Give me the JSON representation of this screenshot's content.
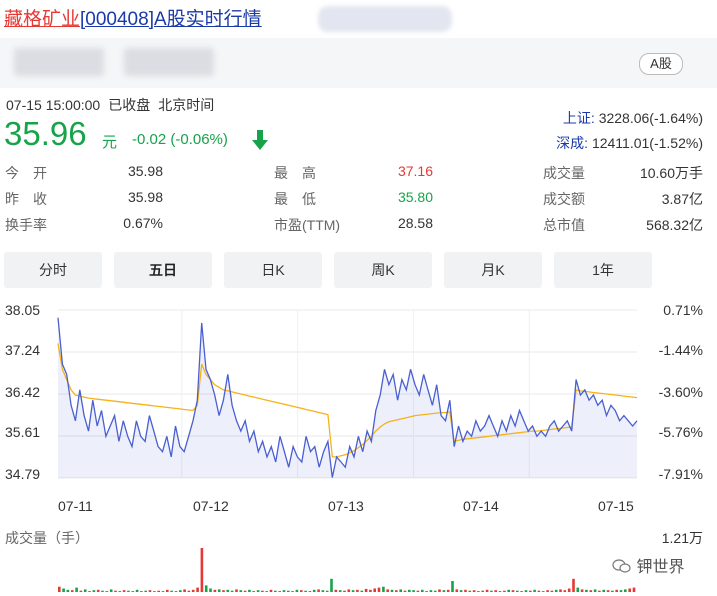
{
  "header": {
    "name_link": "藏格矿业",
    "code_link": "[000408]",
    "title_rest": "A股实时行情",
    "badge": "A股"
  },
  "status": {
    "datetime": "07-15 15:00:00",
    "state": "已收盘",
    "timezone": "北京时间"
  },
  "quote": {
    "price": "35.96",
    "unit": "元",
    "change": "-0.02 (-0.06%)"
  },
  "indices": [
    {
      "label": "上证:",
      "value": "3228.06(-1.64%)"
    },
    {
      "label": "深成:",
      "value": "12411.01(-1.52%)"
    }
  ],
  "stats": [
    {
      "label": "今　开",
      "value": "35.98",
      "color": "#333333"
    },
    {
      "label": "最　高",
      "value": "37.16",
      "color": "#e53935"
    },
    {
      "label": "成交量",
      "value": "10.60万手",
      "color": "#333333"
    },
    {
      "label": "昨　收",
      "value": "35.98",
      "color": "#333333"
    },
    {
      "label": "最　低",
      "value": "35.80",
      "color": "#16a34a"
    },
    {
      "label": "成交额",
      "value": "3.87亿",
      "color": "#333333"
    },
    {
      "label": "换手率",
      "value": "0.67%",
      "color": "#333333"
    },
    {
      "label": "市盈(TTM)",
      "value": "28.58",
      "color": "#333333"
    },
    {
      "label": "总市值",
      "value": "568.32亿",
      "color": "#333333"
    }
  ],
  "tabs": [
    "分时",
    "五日",
    "日K",
    "周K",
    "月K",
    "1年"
  ],
  "active_tab": "五日",
  "colors": {
    "up": "#e53935",
    "down": "#16a34a",
    "price_line": "#4a5fd0",
    "avg_line": "#f5b21a",
    "link": "#1a3aa8"
  },
  "chart_data": {
    "type": "line",
    "y_labels_left": [
      "38.05",
      "37.24",
      "36.42",
      "35.61",
      "34.79"
    ],
    "y_labels_right": [
      "0.71%",
      "-1.44%",
      "-3.60%",
      "-5.76%",
      "-7.91%"
    ],
    "ylim": [
      34.79,
      38.05
    ],
    "x_labels": [
      "07-11",
      "07-12",
      "07-13",
      "07-14",
      "07-15"
    ],
    "grid": true,
    "series": [
      {
        "values": [
          37.9,
          37.0,
          36.8,
          36.2,
          35.9,
          36.5,
          36.0,
          35.7,
          36.3,
          35.8,
          36.1,
          35.6,
          35.8,
          36.0,
          35.5,
          35.9,
          35.6,
          35.4,
          35.9,
          35.6,
          35.5,
          36.0,
          35.7,
          35.4,
          35.3,
          35.6,
          35.2,
          35.8,
          35.4,
          35.3,
          35.6,
          35.9,
          36.3,
          37.8,
          36.9,
          36.7,
          36.4,
          36.0,
          36.3,
          36.8,
          36.2,
          35.9,
          35.7,
          35.9,
          35.5,
          35.7,
          35.3,
          35.5,
          35.2,
          35.4,
          35.1,
          35.6,
          35.3,
          35.0,
          35.4,
          35.2,
          35.1,
          35.6,
          35.3,
          35.4,
          35.0,
          35.3,
          35.5,
          34.8,
          35.2,
          35.1,
          35.0,
          35.4,
          35.2,
          35.6,
          35.3,
          35.7,
          35.5,
          36.1,
          36.4,
          36.9,
          36.6,
          36.8,
          36.3,
          36.7,
          36.5,
          36.9,
          36.6,
          36.4,
          36.8,
          36.5,
          36.2,
          36.6,
          36.0,
          35.9,
          36.3,
          35.4,
          35.8,
          35.5,
          35.7,
          35.6,
          35.9,
          35.7,
          35.8,
          36.0,
          35.8,
          35.6,
          35.9,
          35.7,
          36.0,
          35.8,
          36.1,
          35.9,
          35.7,
          35.8,
          35.6,
          35.7,
          35.6,
          35.8,
          35.9,
          35.7,
          35.8,
          35.9,
          35.7,
          36.7,
          36.4,
          36.5,
          36.3,
          36.4,
          36.2,
          36.3,
          36.0,
          36.2,
          36.1,
          35.9,
          36.0,
          35.9,
          35.8,
          35.9
        ],
        "avg": [
          37.4,
          36.9,
          36.7,
          36.5,
          36.4,
          36.38,
          36.36,
          36.34,
          36.33,
          36.32,
          36.31,
          36.3,
          36.29,
          36.28,
          36.27,
          36.26,
          36.25,
          36.24,
          36.23,
          36.22,
          36.21,
          36.2,
          36.19,
          36.18,
          36.17,
          36.16,
          36.15,
          36.14,
          36.13,
          36.12,
          36.11,
          36.1,
          36.2,
          37.0,
          36.8,
          36.7,
          36.6,
          36.55,
          36.5,
          36.48,
          36.46,
          36.44,
          36.42,
          36.4,
          36.38,
          36.36,
          36.34,
          36.32,
          36.3,
          36.28,
          36.26,
          36.24,
          36.22,
          36.2,
          36.18,
          36.16,
          36.14,
          36.12,
          36.1,
          36.08,
          36.06,
          36.04,
          36.02,
          35.2,
          35.2,
          35.22,
          35.24,
          35.28,
          35.32,
          35.38,
          35.44,
          35.52,
          35.6,
          35.7,
          35.78,
          35.84,
          35.88,
          35.9,
          35.92,
          35.94,
          35.96,
          35.98,
          36.0,
          36.01,
          36.02,
          36.03,
          36.04,
          36.05,
          36.06,
          36.06,
          36.07,
          35.5,
          35.52,
          35.54,
          35.55,
          35.56,
          35.57,
          35.58,
          35.59,
          35.6,
          35.61,
          35.62,
          35.63,
          35.64,
          35.65,
          35.66,
          35.67,
          35.68,
          35.69,
          35.7,
          35.7,
          35.71,
          35.72,
          35.73,
          35.74,
          35.75,
          35.76,
          35.77,
          35.78,
          36.5,
          36.48,
          36.47,
          36.46,
          36.45,
          36.44,
          36.43,
          36.42,
          36.41,
          36.4,
          36.39,
          36.38,
          36.37,
          36.36,
          36.35
        ]
      }
    ],
    "volume": {
      "title": "成交量（手）",
      "max_label": "1.21万",
      "values": [
        0.12,
        0.08,
        0.05,
        0.04,
        0.1,
        0.03,
        0.06,
        0.02,
        0.04,
        0.05,
        0.03,
        0.02,
        0.06,
        0.03,
        0.02,
        0.04,
        0.03,
        0.02,
        0.05,
        0.02,
        0.03,
        0.04,
        0.02,
        0.03,
        0.02,
        0.05,
        0.03,
        0.02,
        0.04,
        0.06,
        0.03,
        0.05,
        0.1,
        1.0,
        0.15,
        0.08,
        0.05,
        0.06,
        0.04,
        0.05,
        0.03,
        0.06,
        0.04,
        0.03,
        0.05,
        0.02,
        0.04,
        0.03,
        0.02,
        0.05,
        0.03,
        0.02,
        0.04,
        0.03,
        0.02,
        0.05,
        0.04,
        0.03,
        0.02,
        0.05,
        0.06,
        0.04,
        0.03,
        0.3,
        0.05,
        0.04,
        0.03,
        0.06,
        0.04,
        0.05,
        0.03,
        0.07,
        0.05,
        0.08,
        0.1,
        0.12,
        0.06,
        0.05,
        0.04,
        0.06,
        0.03,
        0.05,
        0.04,
        0.03,
        0.05,
        0.02,
        0.04,
        0.03,
        0.06,
        0.04,
        0.05,
        0.25,
        0.06,
        0.04,
        0.05,
        0.03,
        0.04,
        0.02,
        0.03,
        0.05,
        0.03,
        0.04,
        0.02,
        0.03,
        0.05,
        0.04,
        0.03,
        0.02,
        0.04,
        0.03,
        0.05,
        0.03,
        0.02,
        0.04,
        0.03,
        0.05,
        0.06,
        0.04,
        0.08,
        0.3,
        0.1,
        0.06,
        0.05,
        0.04,
        0.06,
        0.03,
        0.05,
        0.04,
        0.03,
        0.05,
        0.04,
        0.06,
        0.08,
        0.1
      ],
      "up": [
        1,
        0,
        0,
        1,
        0,
        1,
        0,
        1,
        0,
        1,
        0,
        1,
        0,
        1,
        0,
        1,
        0,
        1,
        0,
        1,
        0,
        1,
        0,
        1,
        0,
        1,
        0,
        1,
        0,
        1,
        1,
        1,
        1,
        1,
        0,
        0,
        1,
        0,
        1,
        0,
        0,
        1,
        0,
        1,
        0,
        1,
        0,
        1,
        0,
        1,
        0,
        1,
        0,
        0,
        1,
        0,
        1,
        0,
        1,
        0,
        1,
        0,
        0,
        0,
        1,
        0,
        1,
        1,
        0,
        1,
        0,
        1,
        1,
        1,
        1,
        0,
        1,
        0,
        1,
        0,
        1,
        0,
        0,
        1,
        0,
        1,
        0,
        0,
        1,
        0,
        1,
        0,
        1,
        0,
        1,
        0,
        1,
        0,
        1,
        1,
        0,
        1,
        0,
        1,
        0,
        1,
        0,
        1,
        0,
        1,
        0,
        1,
        0,
        1,
        1,
        0,
        1,
        1,
        1,
        1,
        0,
        1,
        0,
        1,
        0,
        1,
        0,
        1,
        0,
        1,
        0,
        0,
        1,
        1
      ]
    }
  },
  "watermark": "钾世界"
}
